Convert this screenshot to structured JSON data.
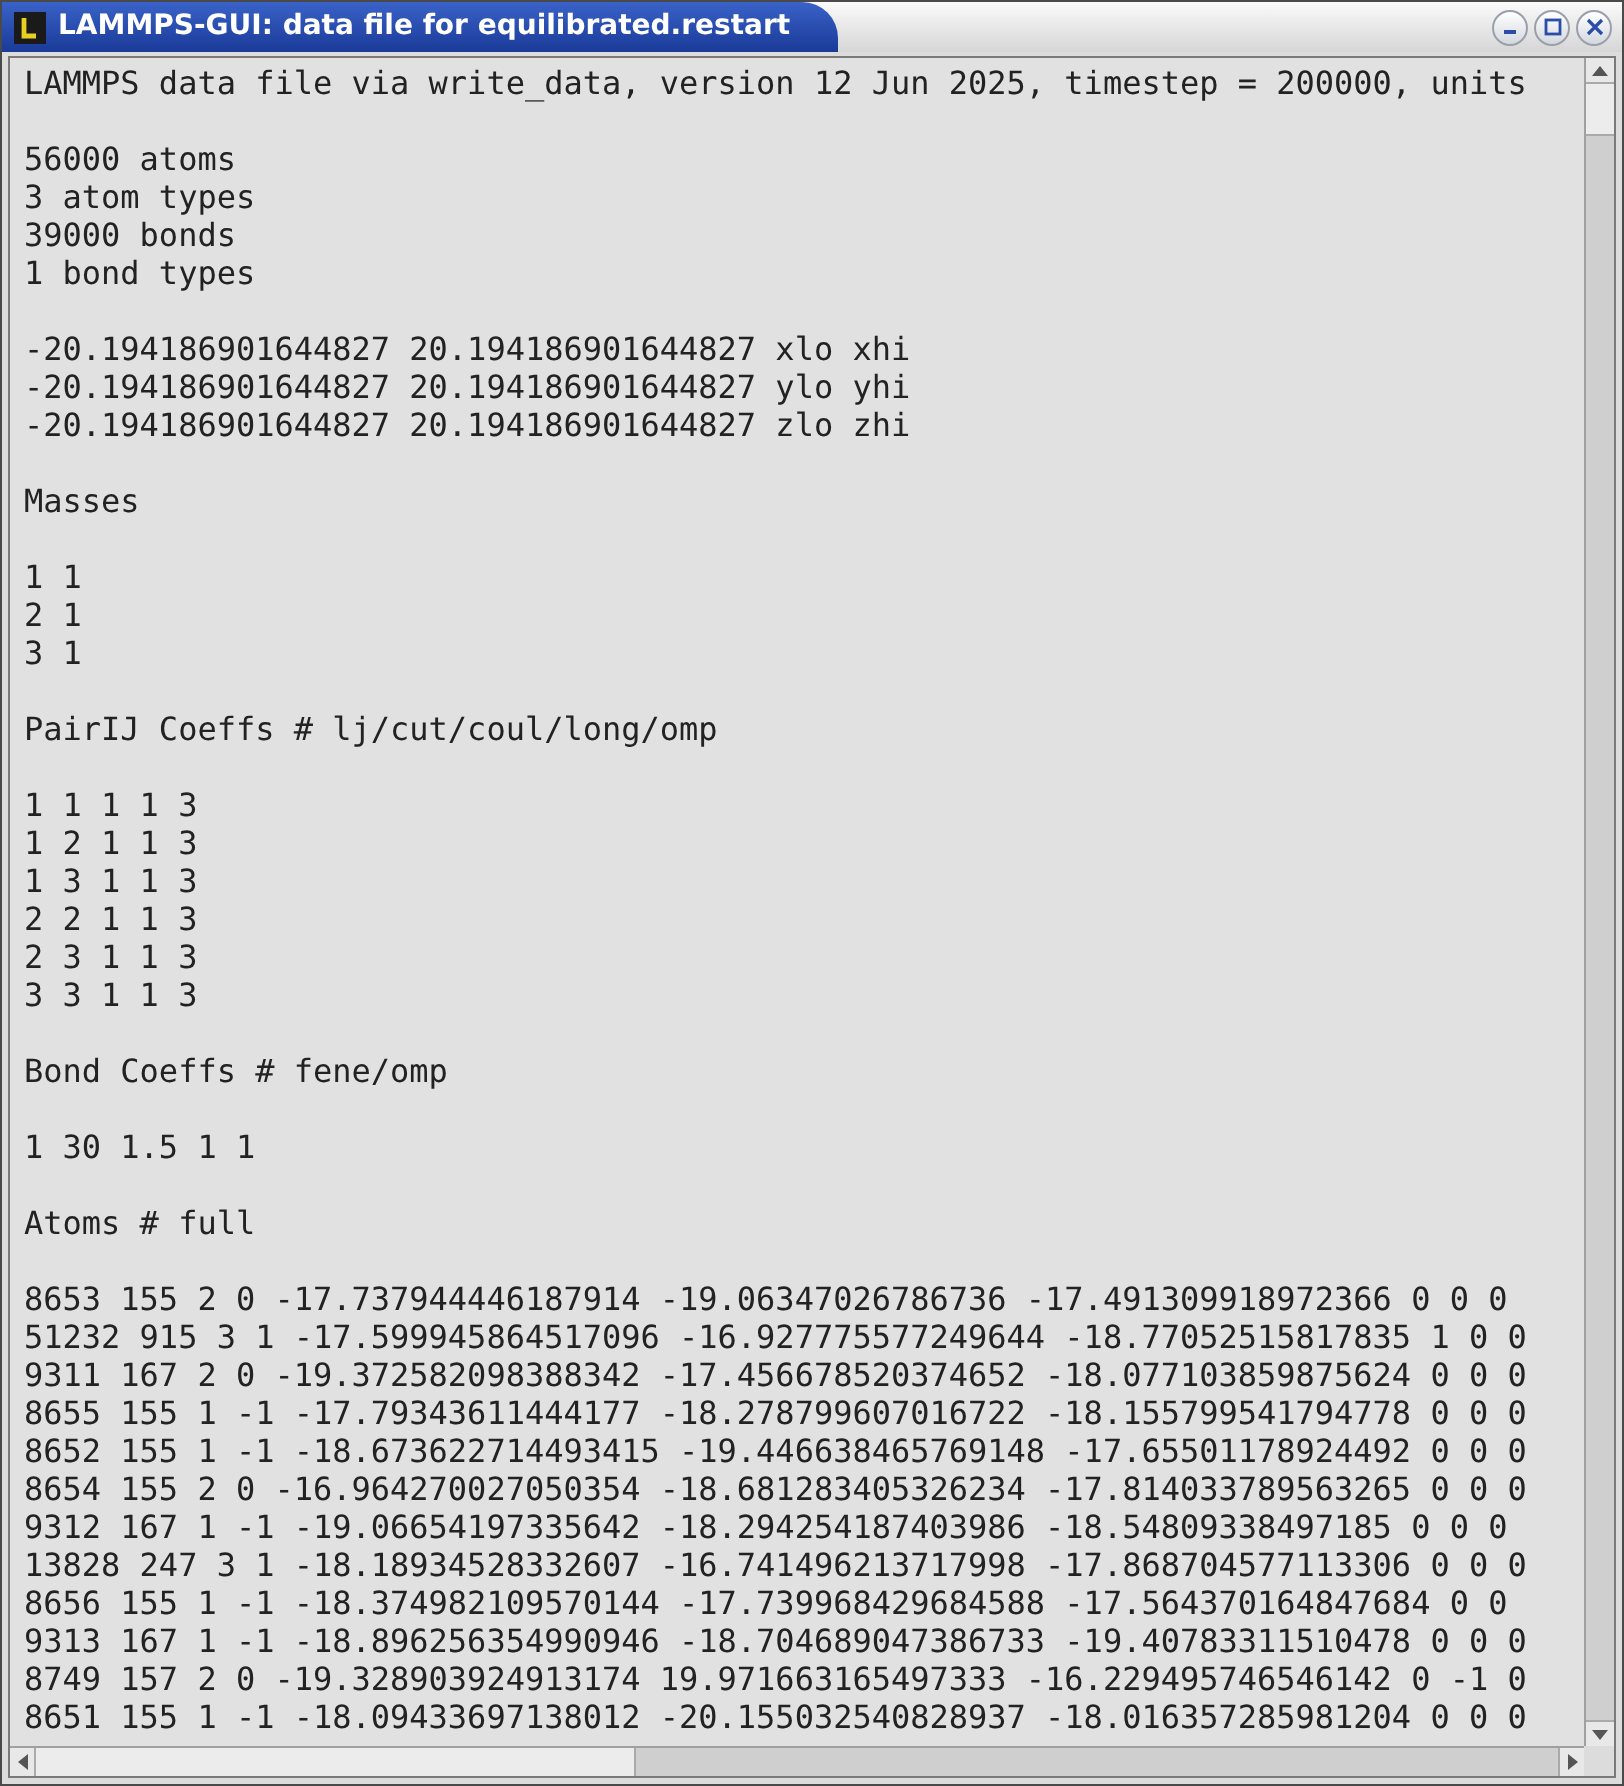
{
  "window": {
    "title": "LAMMPS-GUI: data file for equilibrated.restart"
  },
  "blocks": [
    {
      "lines": [
        "LAMMPS data file via write_data, version 12 Jun 2025, timestep = 200000, units"
      ]
    },
    {
      "lines": [
        "56000 atoms",
        "3 atom types",
        "39000 bonds",
        "1 bond types"
      ]
    },
    {
      "lines": [
        "-20.194186901644827 20.194186901644827 xlo xhi",
        "-20.194186901644827 20.194186901644827 ylo yhi",
        "-20.194186901644827 20.194186901644827 zlo zhi"
      ]
    },
    {
      "lines": [
        "Masses"
      ]
    },
    {
      "lines": [
        "1 1",
        "2 1",
        "3 1"
      ]
    },
    {
      "lines": [
        "PairIJ Coeffs # lj/cut/coul/long/omp"
      ]
    },
    {
      "lines": [
        "1 1 1 1 3",
        "1 2 1 1 3",
        "1 3 1 1 3",
        "2 2 1 1 3",
        "2 3 1 1 3",
        "3 3 1 1 3"
      ]
    },
    {
      "lines": [
        "Bond Coeffs # fene/omp"
      ]
    },
    {
      "lines": [
        "1 30 1.5 1 1"
      ]
    },
    {
      "lines": [
        "Atoms # full"
      ]
    },
    {
      "lines": [
        "8653 155 2 0 -17.737944446187914 -19.06347026786736 -17.491309918972366 0 0 0",
        "51232 915 3 1 -17.599945864517096 -16.927775577249644 -18.77052515817835 1 0 0",
        "9311 167 2 0 -19.372582098388342 -17.456678520374652 -18.077103859875624 0 0 0",
        "8655 155 1 -1 -17.79343611444177 -18.278799607016722 -18.155799541794778 0 0 0",
        "8652 155 1 -1 -18.673622714493415 -19.446638465769148 -17.65501178924492 0 0 0",
        "8654 155 2 0 -16.964270027050354 -18.681283405326234 -17.814033789563265 0 0 0",
        "9312 167 1 -1 -19.06654197335642 -18.294254187403986 -18.54809338497185 0 0 0",
        "13828 247 3 1 -18.18934528332607 -16.741496213717998 -17.868704577113306 0 0 0",
        "8656 155 1 -1 -18.374982109570144 -17.739968429684588 -17.564370164847684 0 0",
        "9313 167 1 -1 -18.896256354990946 -18.704689047386733 -19.40783311510478 0 0 0",
        "8749 157 2 0 -19.328903924913174 19.971663165497333 -16.229495746546142 0 -1 0",
        "8651 155 1 -1 -18.09433697138012 -20.155032540828937 -18.016357285981204 0 0 0"
      ]
    }
  ]
}
